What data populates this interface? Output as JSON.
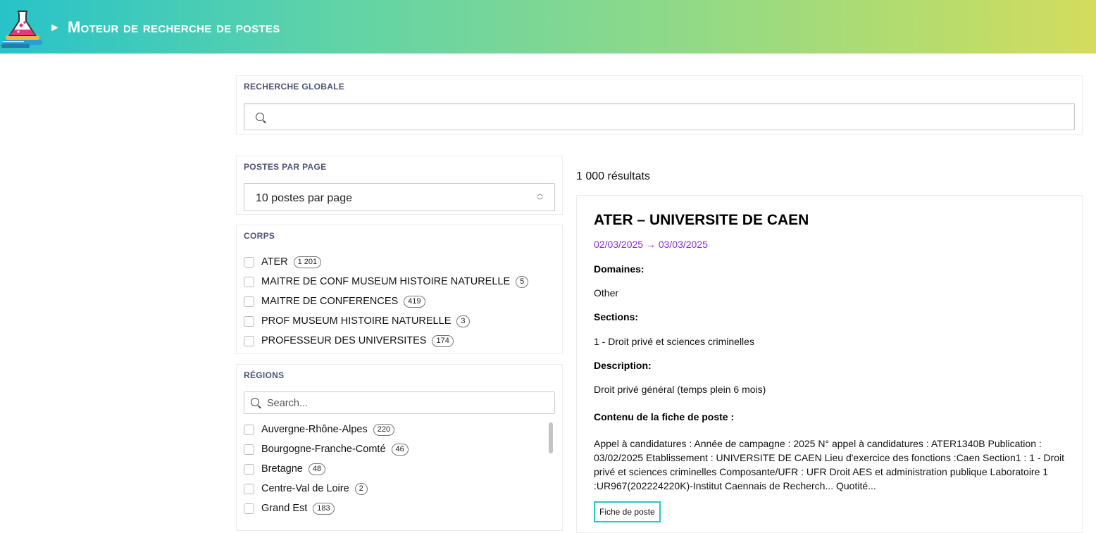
{
  "header": {
    "title": "Moteur de recherche de postes",
    "arrow": "►",
    "logo_icon": "flask-on-books-icon"
  },
  "global_search": {
    "label": "RECHERCHE GLOBALE",
    "value": "",
    "placeholder": ""
  },
  "per_page": {
    "label": "POSTES PAR PAGE",
    "selected": "10 postes par page"
  },
  "corps": {
    "label": "CORPS",
    "items": [
      {
        "label": "ATER",
        "count": "1 201"
      },
      {
        "label": "MAITRE DE CONF MUSEUM HISTOIRE NATURELLE",
        "count": "5"
      },
      {
        "label": "MAITRE DE CONFERENCES",
        "count": "419"
      },
      {
        "label": "PROF MUSEUM HISTOIRE NATURELLE",
        "count": "3"
      },
      {
        "label": "PROFESSEUR DES UNIVERSITES",
        "count": "174"
      }
    ]
  },
  "regions": {
    "label": "RÉGIONS",
    "search_placeholder": "Search...",
    "items": [
      {
        "label": "Auvergne-Rhône-Alpes",
        "count": "220"
      },
      {
        "label": "Bourgogne-Franche-Comté",
        "count": "46"
      },
      {
        "label": "Bretagne",
        "count": "48"
      },
      {
        "label": "Centre-Val de Loire",
        "count": "2"
      },
      {
        "label": "Grand Est",
        "count": "183"
      }
    ]
  },
  "results": {
    "count_text": "1 000 résultats"
  },
  "card": {
    "title": "ATER – UNIVERSITE DE CAEN",
    "dates": "02/03/2025 → 03/03/2025",
    "domaines_label": "Domaines:",
    "domaines_value": "Other",
    "sections_label": "Sections:",
    "sections_value": "1 - Droit privé et sciences criminelles",
    "description_label": "Description:",
    "description_value": "Droit privé général (temps plein 6 mois)",
    "contenu_label": "Contenu de la fiche de poste :",
    "contenu_text": "Appel à candidatures : Année de campagne : 2025 N° appel à candidatures : ATER1340B Publication : 03/02/2025 Etablissement : UNIVERSITE DE CAEN Lieu d'exercice des fonctions :Caen Section1 : 1 - Droit privé et sciences criminelles Composante/UFR : UFR Droit AES et administration publique Laboratoire 1 :UR967(202224220K)-Institut Caennais de Recherch... Quotité...",
    "fiche_button": "Fiche de poste"
  }
}
